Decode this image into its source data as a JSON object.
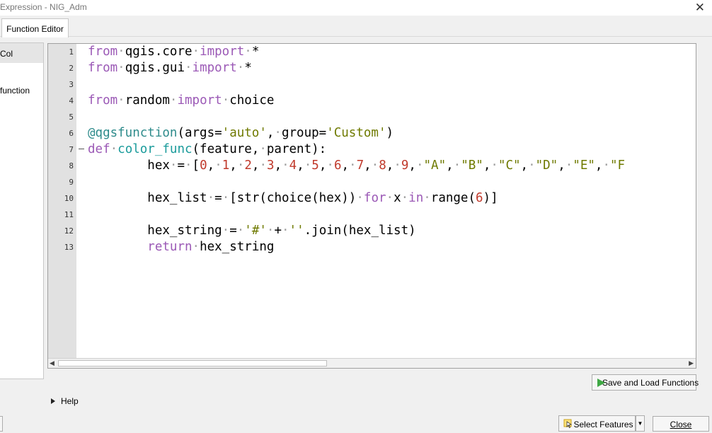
{
  "window": {
    "title": "Expression - NIG_Adm",
    "close_glyph": "✕"
  },
  "tabs": [
    {
      "label": "Function Editor"
    }
  ],
  "left_panel": {
    "items": [
      {
        "label": "Col"
      },
      {
        "label": "function"
      }
    ]
  },
  "editor": {
    "line_numbers": [
      "1",
      "2",
      "3",
      "4",
      "5",
      "6",
      "7",
      "8",
      "9",
      "10",
      "11",
      "12",
      "13"
    ]
  },
  "buttons": {
    "save_load": "Save and Load Functions",
    "select_features": "Select Features",
    "close": "Close",
    "dropdown_glyph": "▼"
  },
  "help": {
    "label": "Help"
  },
  "icons": {
    "run": "play-icon",
    "select": "select-features-icon",
    "expand": "expand-arrow-icon"
  },
  "colors": {
    "keyword": "#9b59b6",
    "string": "#6f7a00",
    "number": "#c0392b",
    "decorator": "#2e8b8b",
    "run_icon": "#3fa845"
  },
  "code": {
    "l1": {
      "a": "from",
      "b": "qgis.core",
      "c": "import",
      "d": "*"
    },
    "l2": {
      "a": "from",
      "b": "qgis.gui",
      "c": "import",
      "d": "*"
    },
    "l4": {
      "a": "from",
      "b": "random",
      "c": "import",
      "d": "choice"
    },
    "l6": {
      "deco": "@qgsfunction",
      "p1": "(args=",
      "s1": "'auto'",
      "p2": ",",
      "p3": "group=",
      "s2": "'Custom'",
      "p4": ")"
    },
    "l7": {
      "kw": "def",
      "fn": "color_func",
      "rest": "(feature,",
      "rest2": "parent):"
    },
    "l8": {
      "name": "hex",
      "eq": "=",
      "open": "[",
      "nums": [
        "0",
        "1",
        "2",
        "3",
        "4",
        "5",
        "6",
        "7",
        "8",
        "9"
      ],
      "strs": [
        "\"A\"",
        "\"B\"",
        "\"C\"",
        "\"D\"",
        "\"E\"",
        "\"F"
      ]
    },
    "l10": {
      "name": "hex_list",
      "eq": "=",
      "p1": "[str(choice(hex))",
      "kw1": "for",
      "x": "x",
      "kw2": "in",
      "r": "range(",
      "n": "6",
      "end": ")]"
    },
    "l12": {
      "name": "hex_string",
      "eq": "=",
      "s1": "'#'",
      "plus": "+",
      "s2": "''",
      "rest": ".join(hex_list)"
    },
    "l13": {
      "kw": "return",
      "name": "hex_string"
    }
  }
}
